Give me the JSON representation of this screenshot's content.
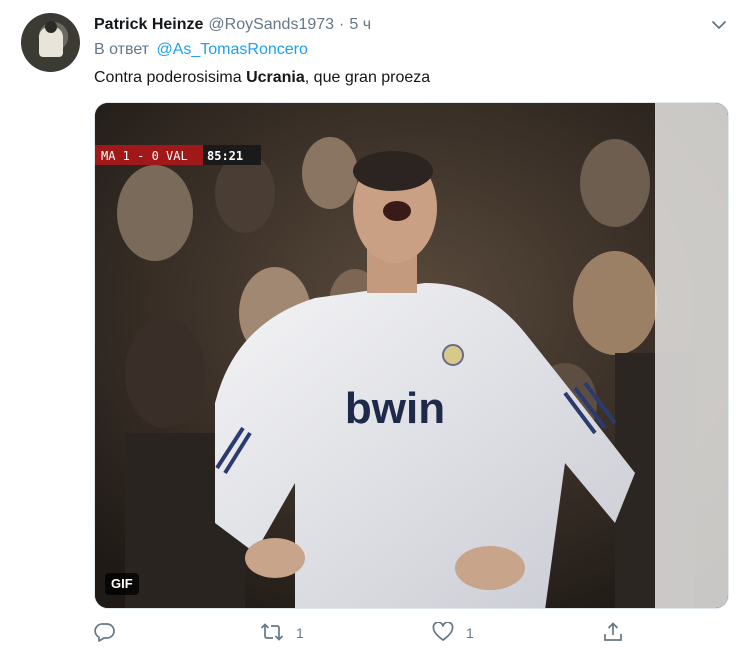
{
  "tweet": {
    "author_name": "Patrick Heinze",
    "author_handle": "@RoySands1973",
    "separator": "·",
    "time": "5 ч",
    "reply_prefix": "В ответ",
    "reply_to": "@As_TomasRoncero",
    "text_before": "Contra poderosisima ",
    "text_bold": "Ucrania",
    "text_after": ", que gran proeza"
  },
  "media": {
    "badge": "GIF",
    "scoreboard": "MA 1 - 0 VAL",
    "clock": "85:21",
    "sponsor": "bwin"
  },
  "actions": {
    "reply_count": "",
    "retweet_count": "1",
    "like_count": "1"
  },
  "icons": {
    "menu": "chevron-down-icon",
    "reply": "comment-icon",
    "retweet": "retweet-icon",
    "like": "heart-icon",
    "share": "share-icon"
  },
  "colors": {
    "link": "#1da1f2",
    "secondary": "#657786",
    "text": "#14171a"
  }
}
